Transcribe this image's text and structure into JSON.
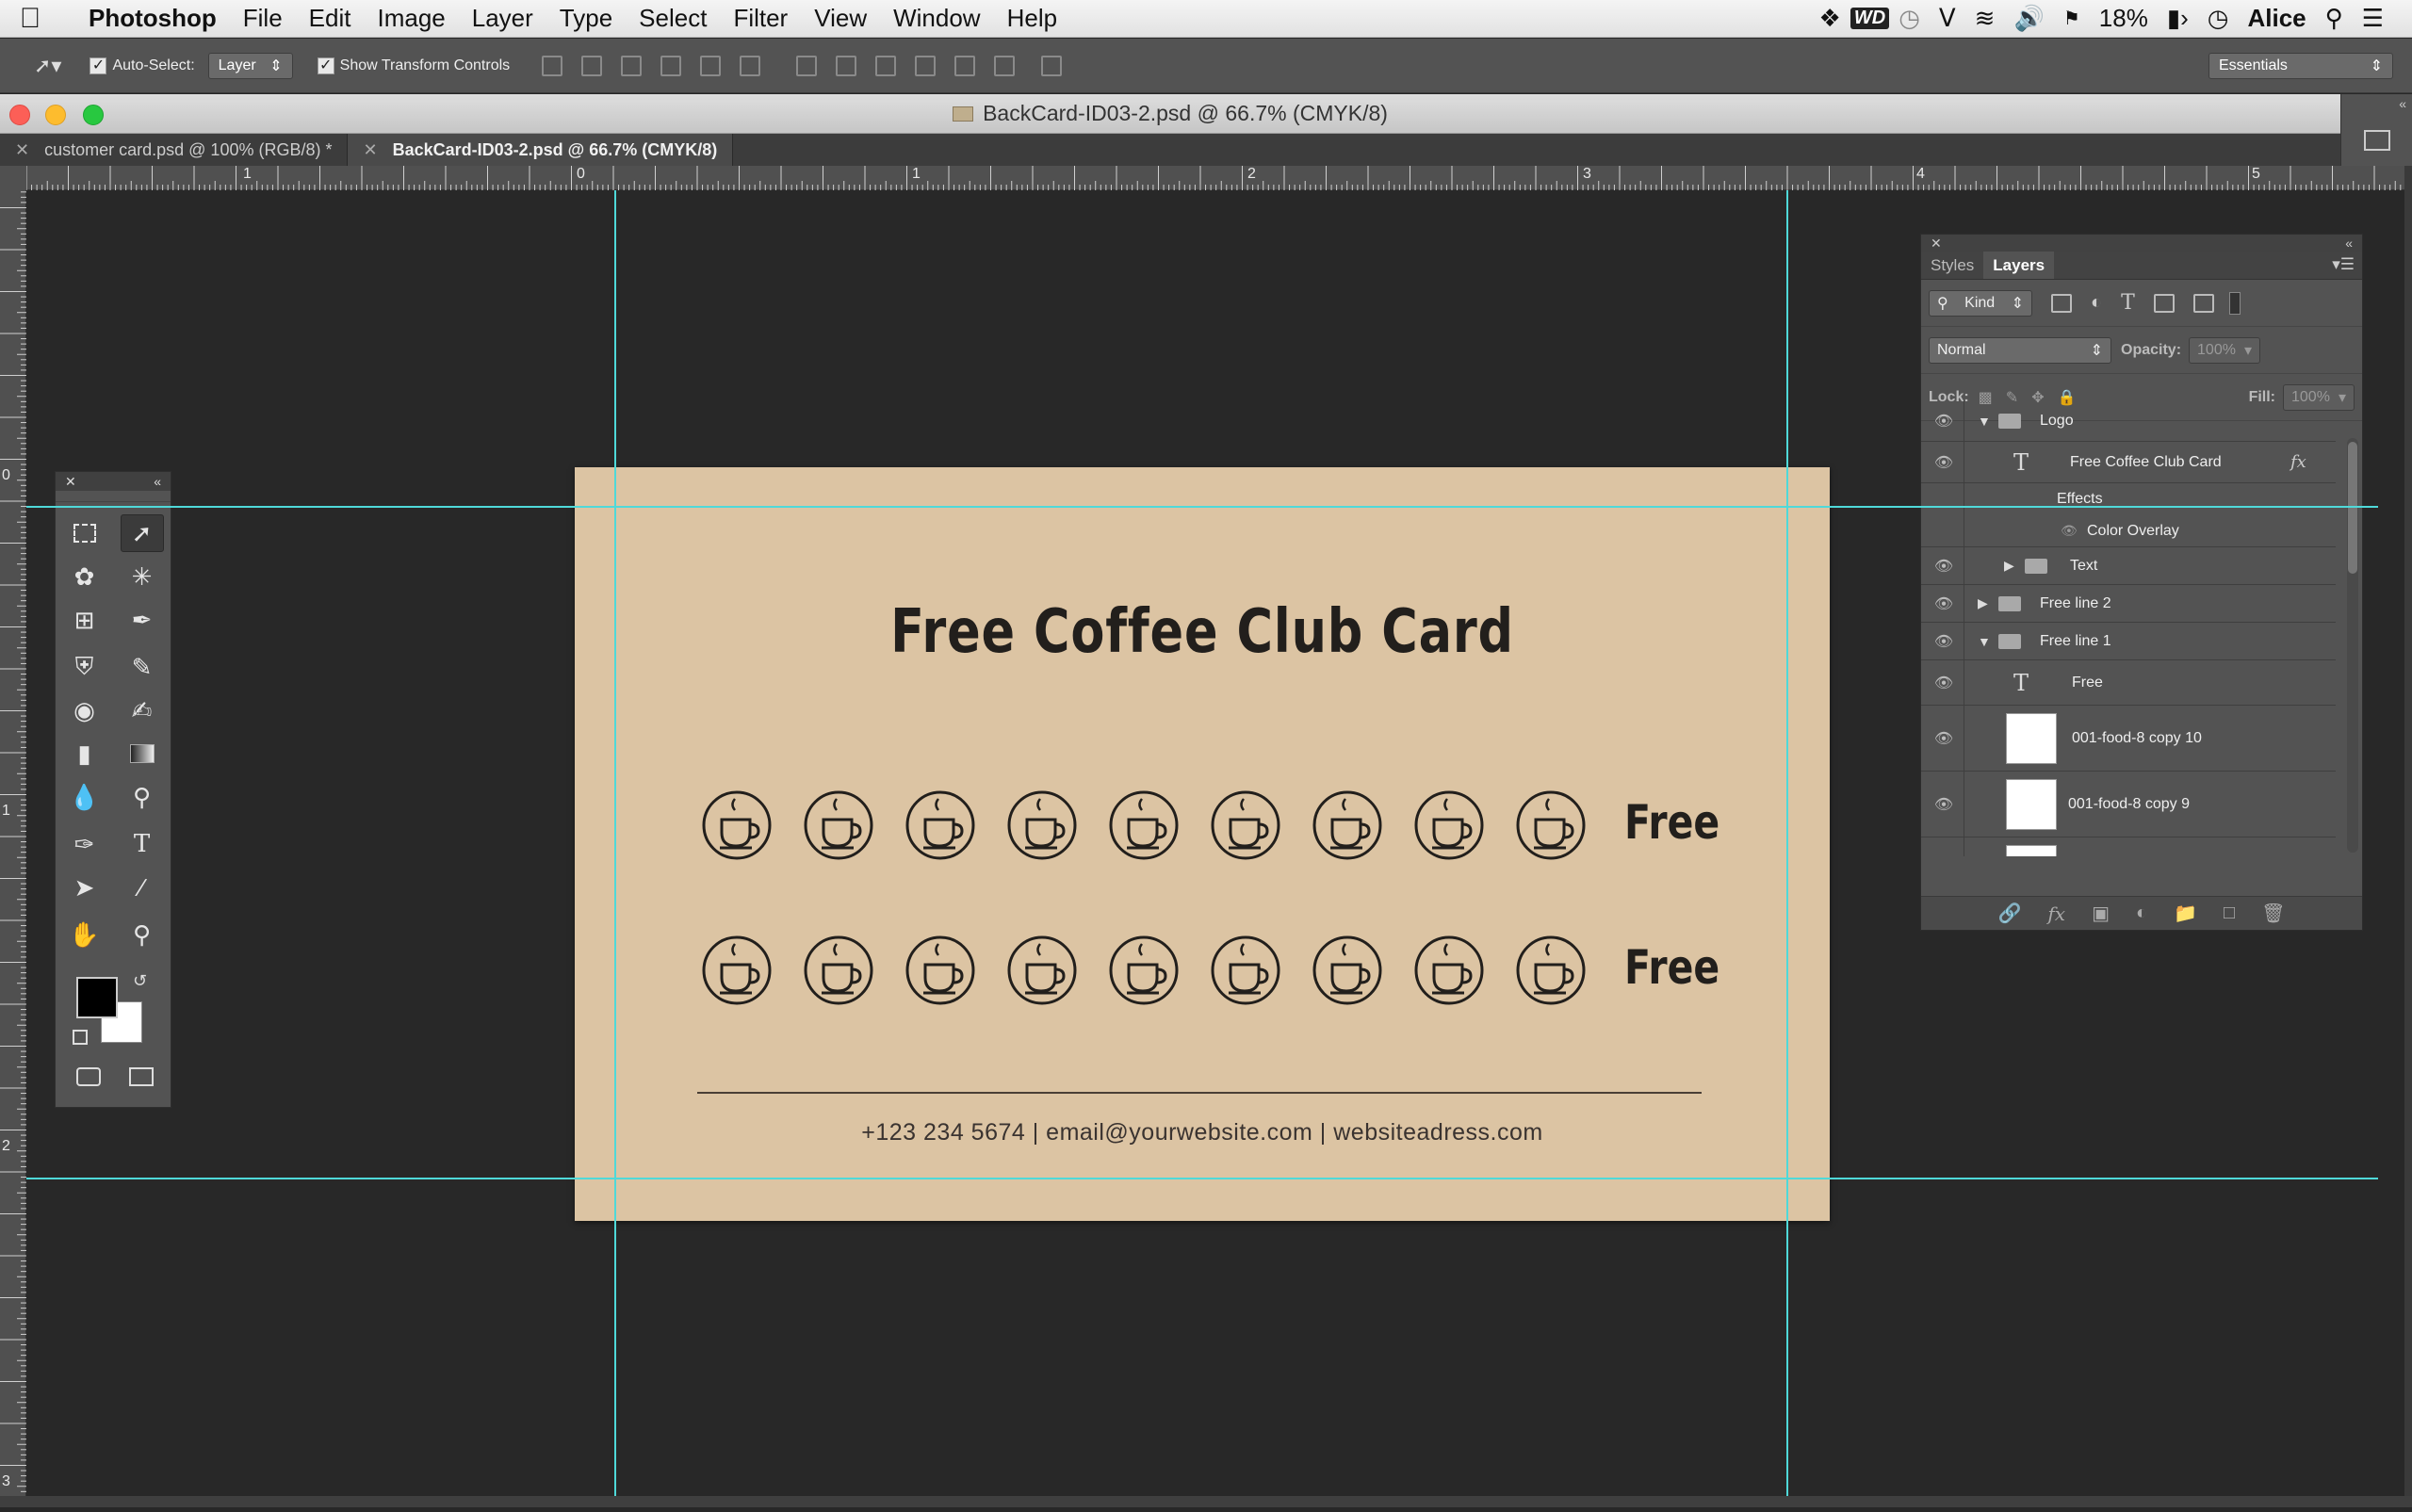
{
  "menubar": {
    "app_name": "Photoshop",
    "items": [
      "File",
      "Edit",
      "Image",
      "Layer",
      "Type",
      "Select",
      "Filter",
      "View",
      "Window",
      "Help"
    ],
    "battery": "18%",
    "user": "Alice"
  },
  "options_bar": {
    "auto_select_label": "Auto-Select:",
    "auto_select_value": "Layer",
    "show_transform_label": "Show Transform Controls",
    "workspace": "Essentials"
  },
  "window": {
    "title": "BackCard-ID03-2.psd @ 66.7% (CMYK/8)",
    "tabs": [
      {
        "label": "customer card.psd @ 100% (RGB/8) *",
        "active": false
      },
      {
        "label": "BackCard-ID03-2.psd @ 66.7% (CMYK/8)",
        "active": true
      }
    ]
  },
  "rulers": {
    "h_labels": [
      "1",
      "0",
      "1",
      "2",
      "3",
      "4",
      "5"
    ],
    "v_labels": [
      "0",
      "1",
      "2",
      "3"
    ]
  },
  "card": {
    "title": "Free Coffee Club Card",
    "row1_free": "Free",
    "row2_free": "Free",
    "cups_per_row": 9,
    "contact": "+123 234 5674  |  email@yourwebsite.com  |  websiteadress.com",
    "background": "#dcc4a3"
  },
  "layers_panel": {
    "tabs": [
      "Styles",
      "Layers"
    ],
    "filter_kind": "Kind",
    "blend_mode": "Normal",
    "opacity_label": "Opacity:",
    "opacity_value": "100%",
    "lock_label": "Lock:",
    "fill_label": "Fill:",
    "fill_value": "100%",
    "layers": {
      "logo": "Logo",
      "free_coffee": "Free Coffee Club Card",
      "effects": "Effects",
      "color_overlay": "Color Overlay",
      "text": "Text",
      "free_line_2": "Free line 2",
      "free_line_1": "Free line 1",
      "free": "Free",
      "food10": "001-food-8 copy 10",
      "food9": "001-food-8 copy 9"
    }
  },
  "colors": {
    "guide": "#4fd9d9",
    "canvas_bg": "#282828",
    "panel_bg": "#535353"
  }
}
